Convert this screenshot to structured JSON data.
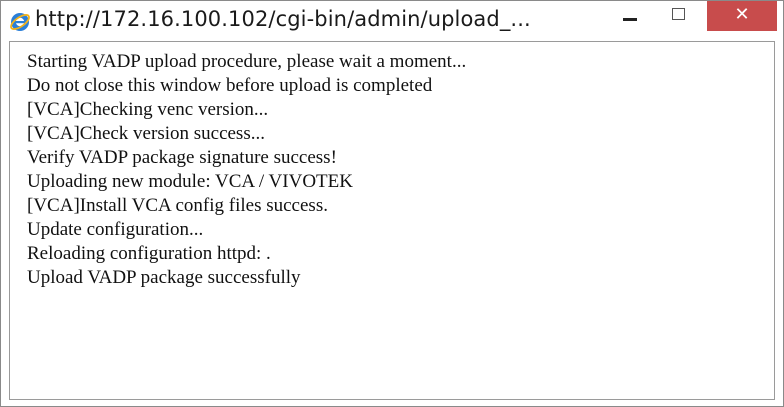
{
  "window": {
    "title": "http://172.16.100.102/cgi-bin/admin/upload_...",
    "icons": {
      "app": "internet-explorer-icon",
      "minimize": "minimize-icon",
      "maximize": "maximize-icon",
      "close": "close-icon"
    },
    "controls": {
      "minimize_glyph": "",
      "maximize_glyph": "",
      "close_glyph": "✕"
    },
    "colors": {
      "close_button": "#c84c4c",
      "ie_icon_blue": "#2b7fd8",
      "ie_icon_ring": "#f2b31c"
    }
  },
  "log": {
    "lines": [
      "Starting VADP upload procedure, please wait a moment...",
      "Do not close this window before upload is completed",
      "[VCA]Checking venc version...",
      "[VCA]Check version success...",
      "Verify VADP package signature success!",
      "Uploading new module: VCA / VIVOTEK",
      "[VCA]Install VCA config files success.",
      "Update configuration...",
      "Reloading configuration httpd: .",
      "Upload VADP package successfully"
    ]
  }
}
